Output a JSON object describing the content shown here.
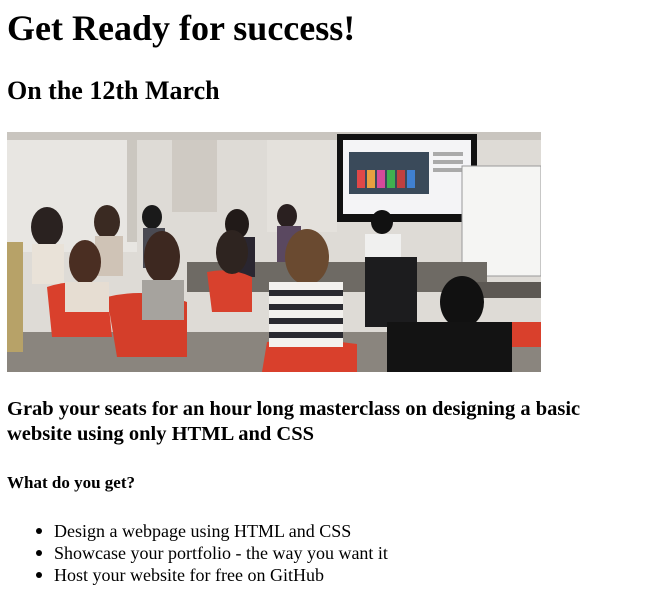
{
  "heading": {
    "title": "Get Ready for success!",
    "date": "On the 12th March"
  },
  "photo": {
    "description_icon": "classroom-photo"
  },
  "pitch": "Grab your seats for an hour long masterclass on designing a basic website using only HTML and CSS",
  "benefits": {
    "heading": "What do you get?",
    "items": [
      "Design a webpage using HTML and CSS",
      "Showcase your portfolio - the way you want it",
      "Host your website for free on GitHub"
    ]
  }
}
